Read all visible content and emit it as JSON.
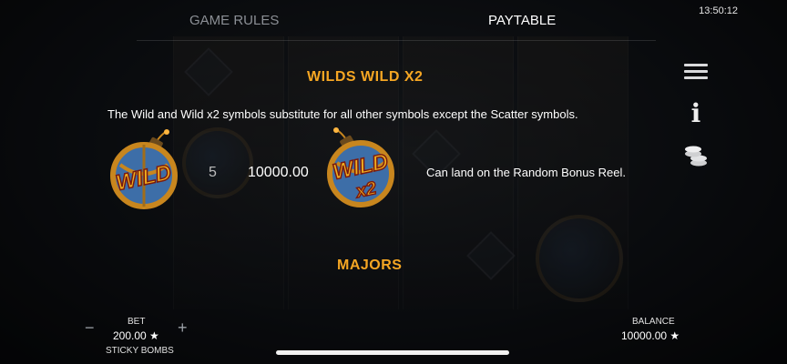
{
  "status": {
    "time": "13:50:12"
  },
  "tabs": [
    {
      "label": "GAME RULES",
      "active": false
    },
    {
      "label": "PAYTABLE",
      "active": true
    }
  ],
  "side_menu": {
    "icons": [
      "hamburger-menu-icon",
      "info-icon",
      "coins-stack-icon"
    ]
  },
  "paytable": {
    "wilds": {
      "title": "WILDS WILD X2",
      "description": "The Wild and Wild x2 symbols substitute for all other symbols except the Scatter symbols.",
      "wild": {
        "symbol_text": "WILD",
        "count": "5",
        "payout": "10000.00"
      },
      "wild_x2": {
        "symbol_text": "WILD",
        "multiplier_text": "x2",
        "note": "Can land on the Random Bonus Reel."
      }
    },
    "majors": {
      "title": "MAJORS"
    }
  },
  "footer": {
    "bet_label": "BET",
    "bet_value": "200.00 ★",
    "minus": "−",
    "plus": "+",
    "game_name": "STICKY BOMBS",
    "balance_label": "BALANCE",
    "balance_value": "10000.00 ★"
  },
  "colors": {
    "accent": "#f5a623",
    "wild_text": "#f0b020",
    "bomb_ring": "#c8861e",
    "bomb_body": "#3d6ea8"
  }
}
